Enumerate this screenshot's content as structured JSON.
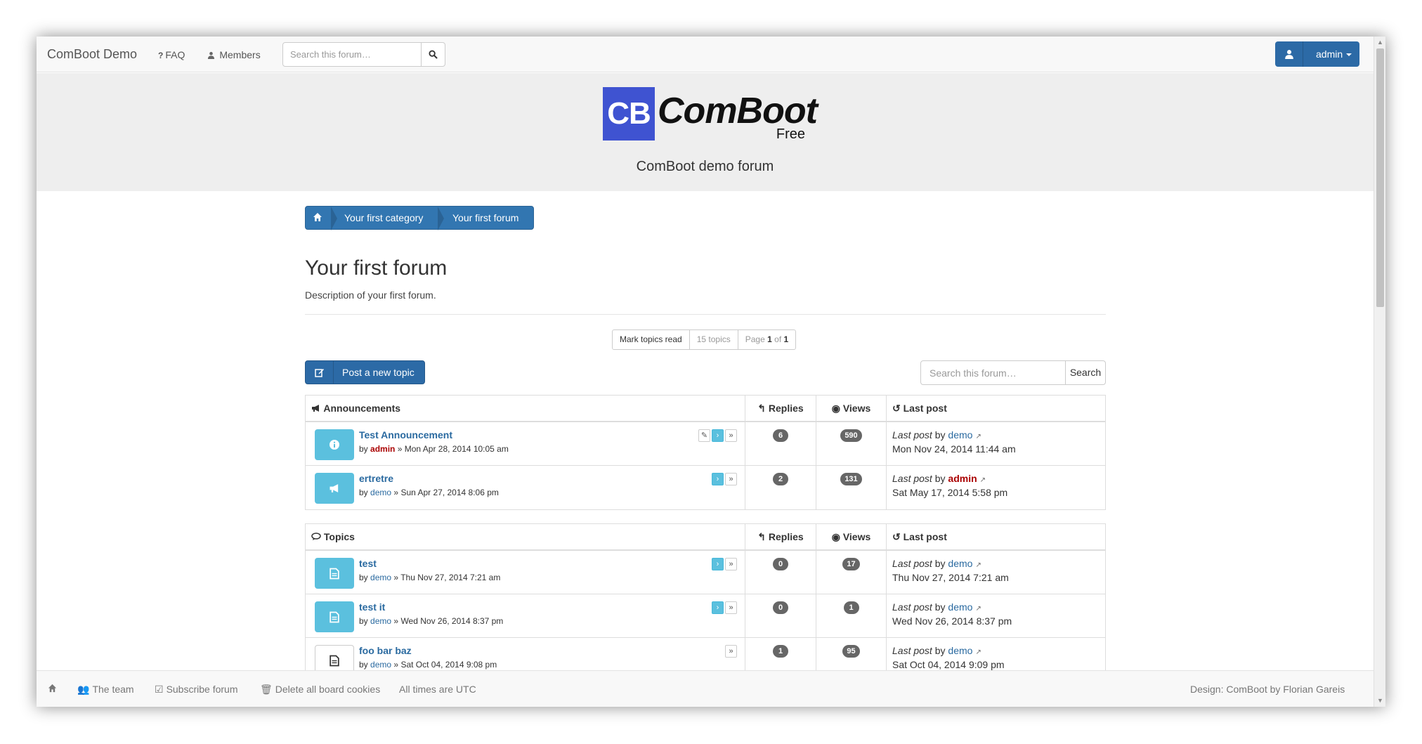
{
  "nav": {
    "brand": "ComBoot Demo",
    "faq": "FAQ",
    "members": "Members",
    "search_placeholder": "Search this forum…",
    "user": "admin"
  },
  "header": {
    "logo_abbr": "CB",
    "logo_name": "ComBoot",
    "logo_sub": "Free",
    "site_desc": "ComBoot demo forum"
  },
  "breadcrumb": {
    "category": "Your first category",
    "forum": "Your first forum"
  },
  "forum": {
    "title": "Your first forum",
    "description": "Description of your first forum."
  },
  "pagination": {
    "mark_read": "Mark topics read",
    "topic_count": "15 topics",
    "page_prefix": "Page",
    "page_current": "1",
    "page_of": "of",
    "page_total": "1"
  },
  "actions": {
    "post_new_topic": "Post a new topic",
    "search_placeholder": "Search this forum…",
    "search_button": "Search"
  },
  "columns": {
    "replies": "Replies",
    "views": "Views",
    "last_post": "Last post"
  },
  "announcements": {
    "heading": "Announcements",
    "rows": [
      {
        "title": "Test Announcement",
        "author": "admin",
        "date": "Mon Apr 28, 2014 10:05 am",
        "replies": "6",
        "views": "590",
        "last_by": "demo",
        "last_date": "Mon Nov 24, 2014 11:44 am"
      },
      {
        "title": "ertretre",
        "author": "demo",
        "date": "Sun Apr 27, 2014 8:06 pm",
        "replies": "2",
        "views": "131",
        "last_by": "admin",
        "last_date": "Sat May 17, 2014 5:58 pm"
      }
    ]
  },
  "topics": {
    "heading": "Topics",
    "rows": [
      {
        "title": "test",
        "author": "demo",
        "date": "Thu Nov 27, 2014 7:21 am",
        "replies": "0",
        "views": "17",
        "last_by": "demo",
        "last_date": "Thu Nov 27, 2014 7:21 am"
      },
      {
        "title": "test it",
        "author": "demo",
        "date": "Wed Nov 26, 2014 8:37 pm",
        "replies": "0",
        "views": "1",
        "last_by": "demo",
        "last_date": "Wed Nov 26, 2014 8:37 pm"
      },
      {
        "title": "foo bar baz",
        "author": "demo",
        "date": "Sat Oct 04, 2014 9:08 pm",
        "replies": "1",
        "views": "95",
        "last_by": "demo",
        "last_date": "Sat Oct 04, 2014 9:09 pm"
      }
    ]
  },
  "strings": {
    "by": "by",
    "sep": "»",
    "last_post_label": "Last post",
    "by_word": "by"
  },
  "footer": {
    "team": "The team",
    "subscribe": "Subscribe forum",
    "delete_cookies": "Delete all board cookies",
    "timezone": "All times are UTC",
    "design": "Design: ComBoot by Florian Gareis"
  },
  "colors": {
    "primary": "#3276b1",
    "info": "#5bc0de",
    "admin_user": "#aa0000",
    "link": "#2a6aa0"
  }
}
